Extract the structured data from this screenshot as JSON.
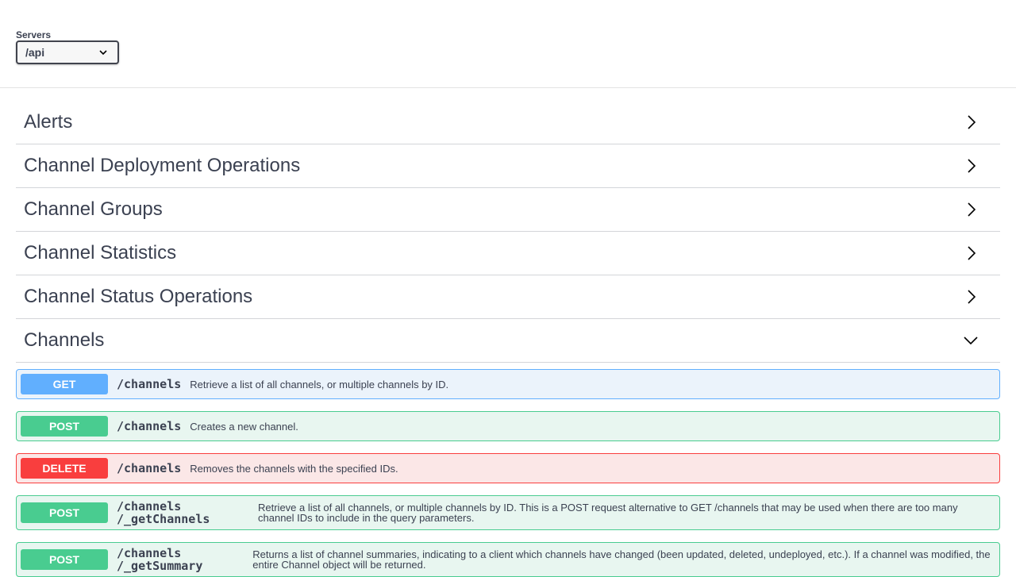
{
  "servers": {
    "label": "Servers",
    "selected": "/api"
  },
  "tags": [
    {
      "name": "Alerts",
      "expanded": false
    },
    {
      "name": "Channel Deployment Operations",
      "expanded": false
    },
    {
      "name": "Channel Groups",
      "expanded": false
    },
    {
      "name": "Channel Statistics",
      "expanded": false
    },
    {
      "name": "Channel Status Operations",
      "expanded": false
    },
    {
      "name": "Channels",
      "expanded": true
    }
  ],
  "operations": [
    {
      "method": "GET",
      "path": "/channels",
      "summary": "Retrieve a list of all channels, or multiple channels by ID."
    },
    {
      "method": "POST",
      "path": "/channels",
      "summary": "Creates a new channel."
    },
    {
      "method": "DELETE",
      "path": "/channels",
      "summary": "Removes the channels with the specified IDs."
    },
    {
      "method": "POST",
      "path": "/channels\n/_getChannels",
      "path_line1": "/channels",
      "path_line2": "/_getChannels",
      "summary": "Retrieve a list of all channels, or multiple channels by ID. This is a POST request alternative to GET /channels that may be used when there are too many channel IDs to include in the query parameters."
    },
    {
      "method": "POST",
      "path_line1": "/channels",
      "path_line2": "/_getSummary",
      "summary": "Returns a list of channel summaries, indicating to a client which channels have changed (been updated, deleted, undeployed, etc.). If a channel was modified, the entire Channel object will be returned."
    }
  ],
  "colors": {
    "get": "#61affe",
    "post": "#49cc90",
    "delete": "#f93e3e",
    "text": "#3b4151"
  },
  "icons": {
    "collapsed": "chevron-right-icon",
    "expanded": "chevron-down-icon",
    "select": "chevron-down-icon"
  }
}
